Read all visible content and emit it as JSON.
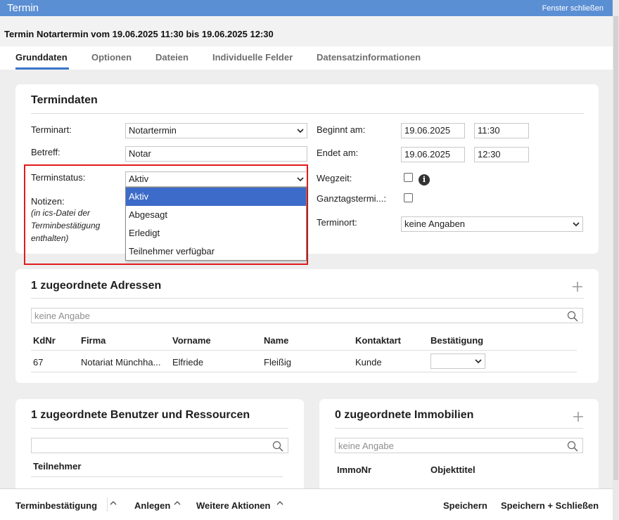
{
  "window": {
    "title": "Termin",
    "close_label": "Fenster schließen"
  },
  "header": {
    "subject": "Termin Notartermin vom 19.06.2025 11:30 bis 19.06.2025 12:30"
  },
  "tabs": [
    {
      "label": "Grunddaten",
      "active": true
    },
    {
      "label": "Optionen"
    },
    {
      "label": "Dateien"
    },
    {
      "label": "Individuelle Felder"
    },
    {
      "label": "Datensatzinformationen"
    }
  ],
  "termindaten": {
    "title": "Termindaten",
    "terminart_label": "Terminart:",
    "terminart_value": "Notartermin",
    "betreff_label": "Betreff:",
    "betreff_value": "Notar",
    "terminstatus_label": "Terminstatus:",
    "terminstatus_value": "Aktiv",
    "terminstatus_options": [
      "Aktiv",
      "Abgesagt",
      "Erledigt",
      "Teilnehmer verfügbar"
    ],
    "notizen_label": "Notizen:",
    "notizen_sub": "(in ics-Datei der Terminbestätigung enthalten)",
    "beginnt_label": "Beginnt am:",
    "beginnt_date": "19.06.2025",
    "beginnt_time": "11:30",
    "endet_label": "Endet am:",
    "endet_date": "19.06.2025",
    "endet_time": "12:30",
    "wegzeit_label": "Wegzeit:",
    "ganztag_label": "Ganztagstermi...:",
    "terminort_label": "Terminort:",
    "terminort_value": "keine Angaben",
    "info_glyph": "i"
  },
  "adressen": {
    "title": "1 zugeordnete Adressen",
    "search_placeholder": "keine Angabe",
    "columns": [
      "KdNr",
      "Firma",
      "Vorname",
      "Name",
      "Kontaktart",
      "Bestätigung"
    ],
    "rows": [
      {
        "kdnr": "67",
        "firma": "Notariat Münchha...",
        "vorname": "Elfriede",
        "name": "Fleißig",
        "kontaktart": "Kunde",
        "bestaetigung": ""
      }
    ]
  },
  "benutzer": {
    "title": "1 zugeordnete Benutzer und Ressourcen",
    "search_placeholder": "",
    "columns": [
      "Teilnehmer"
    ]
  },
  "immobilien": {
    "title": "0 zugeordnete Immobilien",
    "search_placeholder": "keine Angabe",
    "columns": [
      "ImmoNr",
      "Objekttitel"
    ]
  },
  "footer": {
    "terminbestaetigung": "Terminbestätigung",
    "anlegen": "Anlegen",
    "weitere_aktionen": "Weitere Aktionen",
    "speichern": "Speichern",
    "speichern_schliessen": "Speichern + Schließen"
  },
  "icons": {
    "plus": "plus-icon",
    "search": "search-icon",
    "chevron_down": "chevron-down-icon",
    "chevron_up": "chevron-up-icon",
    "info": "info-icon"
  },
  "colors": {
    "titlebar": "#5b8fd4",
    "tab_active_underline": "#3b74c9",
    "dropdown_selected": "#3c6bc9",
    "highlight_box": "#e01b1b",
    "content_bg": "#eeeeef"
  }
}
